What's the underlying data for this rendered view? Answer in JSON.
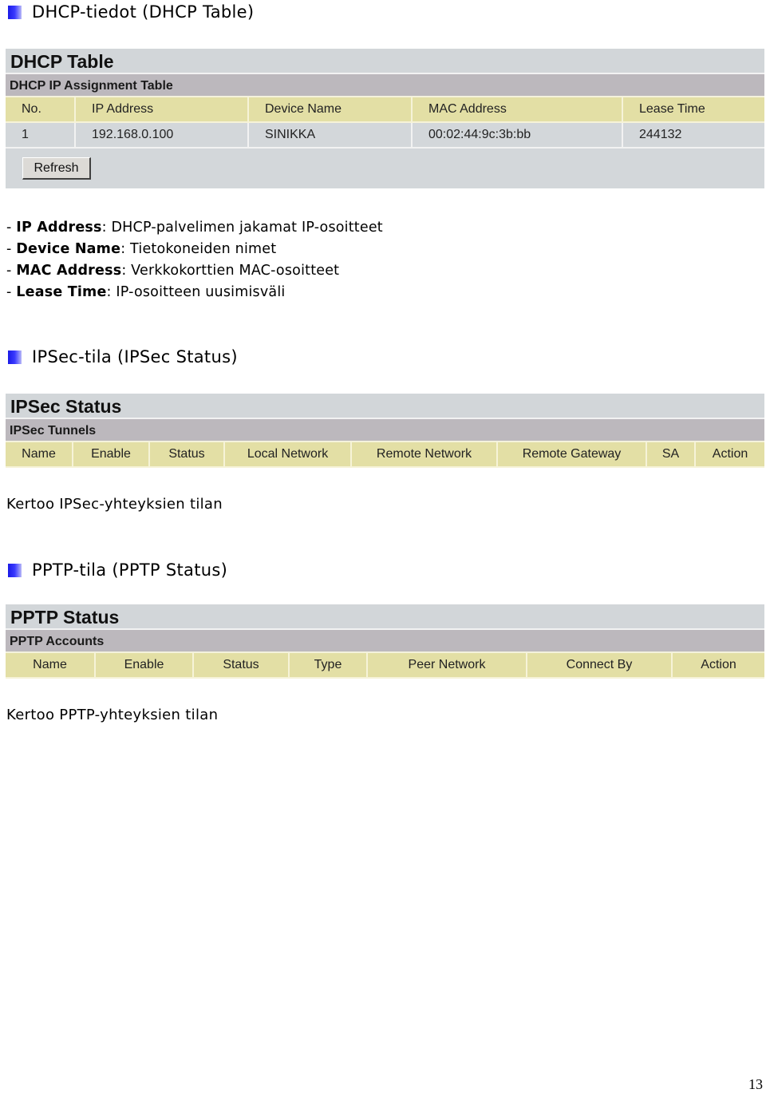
{
  "sections": {
    "dhcp": {
      "heading": "DHCP-tiedot (DHCP Table)",
      "panel_title": "DHCP Table",
      "panel_subtitle": "DHCP IP Assignment Table",
      "columns": [
        "No.",
        "IP Address",
        "Device Name",
        "MAC Address",
        "Lease Time"
      ],
      "rows": [
        [
          "1",
          "192.168.0.100",
          "SINIKKA",
          "00:02:44:9c:3b:bb",
          "244132"
        ]
      ],
      "refresh_label": "Refresh",
      "descriptions": [
        {
          "term": "IP Address",
          "text": "DHCP-palvelimen jakamat IP-osoitteet"
        },
        {
          "term": "Device Name",
          "text": "Tietokoneiden nimet"
        },
        {
          "term": "MAC Address",
          "text": "Verkkokorttien MAC-osoitteet"
        },
        {
          "term": "Lease Time",
          "text": "IP-osoitteen uusimisväli"
        }
      ]
    },
    "ipsec": {
      "heading": "IPSec-tila (IPSec Status)",
      "panel_title": "IPSec Status",
      "panel_subtitle": "IPSec Tunnels",
      "columns": [
        "Name",
        "Enable",
        "Status",
        "Local Network",
        "Remote Network",
        "Remote Gateway",
        "SA",
        "Action"
      ],
      "description": "Kertoo IPSec-yhteyksien tilan"
    },
    "pptp": {
      "heading": "PPTP-tila (PPTP Status)",
      "panel_title": "PPTP Status",
      "panel_subtitle": "PPTP Accounts",
      "columns": [
        "Name",
        "Enable",
        "Status",
        "Type",
        "Peer Network",
        "Connect By",
        "Action"
      ],
      "description": "Kertoo PPTP-yhteyksien tilan"
    }
  },
  "page_number": "13",
  "colors": {
    "bullet": "#2a2aff",
    "panel_title_bg": "#d2d6d9",
    "panel_subtitle_bg": "#bcb8bd",
    "header_row_bg": "#e3dfa5",
    "data_row_bg": "#d3d7da"
  }
}
